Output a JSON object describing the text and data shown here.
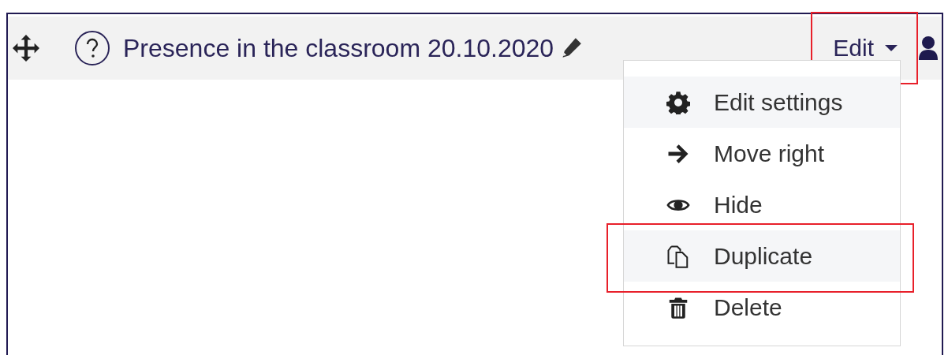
{
  "activity": {
    "title": "Presence in the classroom 20.10.2020"
  },
  "edit_menu": {
    "label": "Edit",
    "annotated": true,
    "expanded": true,
    "items": [
      {
        "kind": "settings",
        "label": "Edit settings",
        "highlighted": true,
        "annotated": false
      },
      {
        "kind": "move",
        "label": "Move right",
        "highlighted": false,
        "annotated": false
      },
      {
        "kind": "hide",
        "label": "Hide",
        "highlighted": false,
        "annotated": false
      },
      {
        "kind": "duplicate",
        "label": "Duplicate",
        "highlighted": true,
        "annotated": true
      },
      {
        "kind": "delete",
        "label": "Delete",
        "highlighted": false,
        "annotated": false
      }
    ]
  }
}
